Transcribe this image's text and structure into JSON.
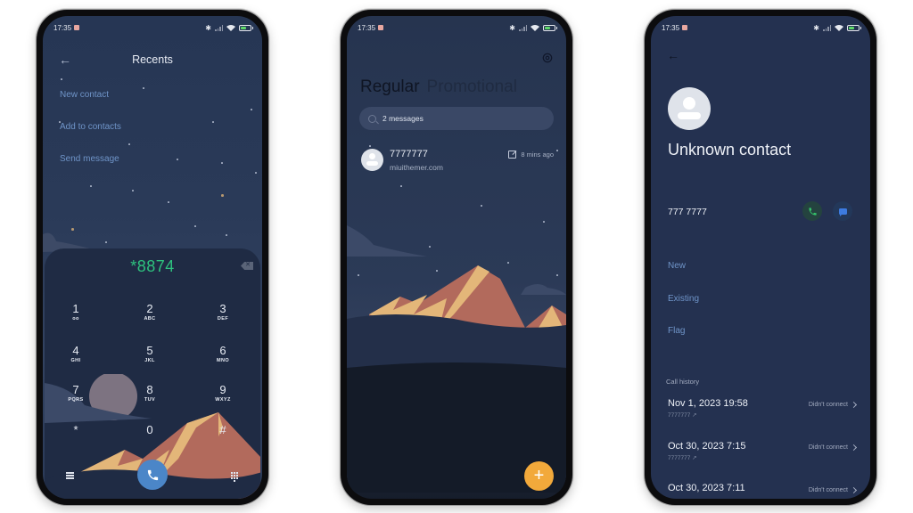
{
  "status_bar": {
    "time": "17:35"
  },
  "phone1": {
    "title": "Recents",
    "menu": [
      "New contact",
      "Add to contacts",
      "Send message"
    ],
    "dialed_number": "*8874",
    "keys": [
      {
        "digit": "1",
        "letters": "oo"
      },
      {
        "digit": "2",
        "letters": "ABC"
      },
      {
        "digit": "3",
        "letters": "DEF"
      },
      {
        "digit": "4",
        "letters": "GHI"
      },
      {
        "digit": "5",
        "letters": "JKL"
      },
      {
        "digit": "6",
        "letters": "MNO"
      },
      {
        "digit": "7",
        "letters": "PQRS"
      },
      {
        "digit": "8",
        "letters": "TUV"
      },
      {
        "digit": "9",
        "letters": "WXYZ"
      },
      {
        "digit": "*",
        "letters": ""
      },
      {
        "digit": "0",
        "letters": "+"
      },
      {
        "digit": "#",
        "letters": ""
      }
    ],
    "accent": "#2ec27e",
    "call_button_color": "#4b86c8"
  },
  "phone2": {
    "tabs": [
      "Regular",
      "Promotional"
    ],
    "search_placeholder": "2 messages",
    "thread": {
      "name": "7777777",
      "preview": "miuithemer.com",
      "time": "8 mins ago"
    },
    "fab_label": "+",
    "fab_color": "#f2a93b"
  },
  "phone3": {
    "contact_name": "Unknown contact",
    "number": "777 7777",
    "options": [
      "New",
      "Existing",
      "Flag"
    ],
    "history_label": "Call history",
    "history": [
      {
        "date": "Nov 1, 2023 19:58",
        "number": "7777777 ↗",
        "status": "Didn't connect"
      },
      {
        "date": "Oct 30, 2023 7:15",
        "number": "7777777 ↗",
        "status": "Didn't connect"
      },
      {
        "date": "Oct 30, 2023 7:11",
        "number": "",
        "status": "Didn't connect"
      }
    ]
  }
}
